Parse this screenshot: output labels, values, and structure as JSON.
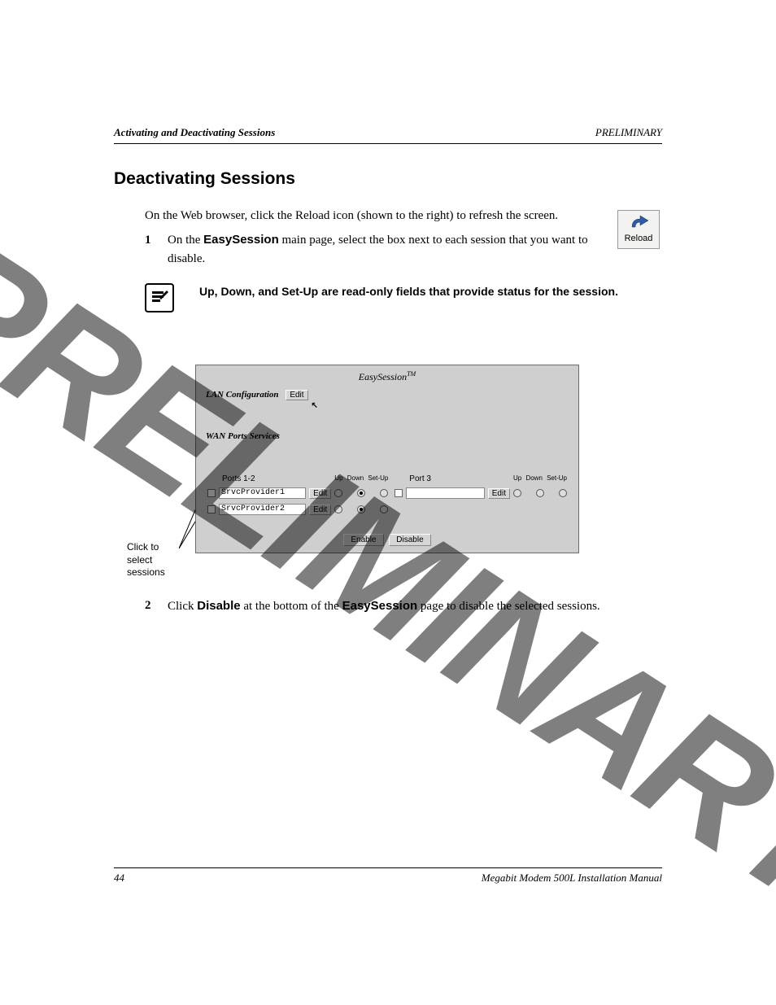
{
  "header": {
    "left": "Activating and Deactivating Sessions",
    "right": "PRELIMINARY"
  },
  "heading": "Deactivating Sessions",
  "intro": "On the Web browser, click the Reload icon (shown to the right) to refresh the screen.",
  "step1": {
    "num": "1",
    "before_bold": "On the ",
    "bold": "EasySession",
    "after_bold": " main page, select the box next to each session that you want to disable."
  },
  "reload_label": "Reload",
  "note": "Up, Down, and Set-Up are read-only fields that provide status for the session.",
  "callout": "Click to select sessions",
  "panel": {
    "title_main": "EasySession",
    "title_tm": "TM",
    "lan_label": "LAN Configuration",
    "edit_label": "Edit",
    "wan_label": "WAN Ports Services",
    "col_up": "Up",
    "col_down": "Down",
    "col_setup": "Set-Up",
    "ports12_label": "Ports 1-2",
    "port3_label": "Port 3",
    "providers12": [
      {
        "name": "SrvcProvider1",
        "selected_col": 1
      },
      {
        "name": "SrvcProvider2",
        "selected_col": 1
      }
    ],
    "enable_label": "Enable",
    "disable_label": "Disable"
  },
  "step2": {
    "num": "2",
    "t1": "Click ",
    "b1": "Disable",
    "t2": " at the bottom of the ",
    "b2": "EasySession",
    "t3": " page to disable the selected sessions."
  },
  "footer": {
    "page": "44",
    "manual": "Megabit Modem 500L Installation Manual"
  },
  "watermark": "PRELIMINARY"
}
